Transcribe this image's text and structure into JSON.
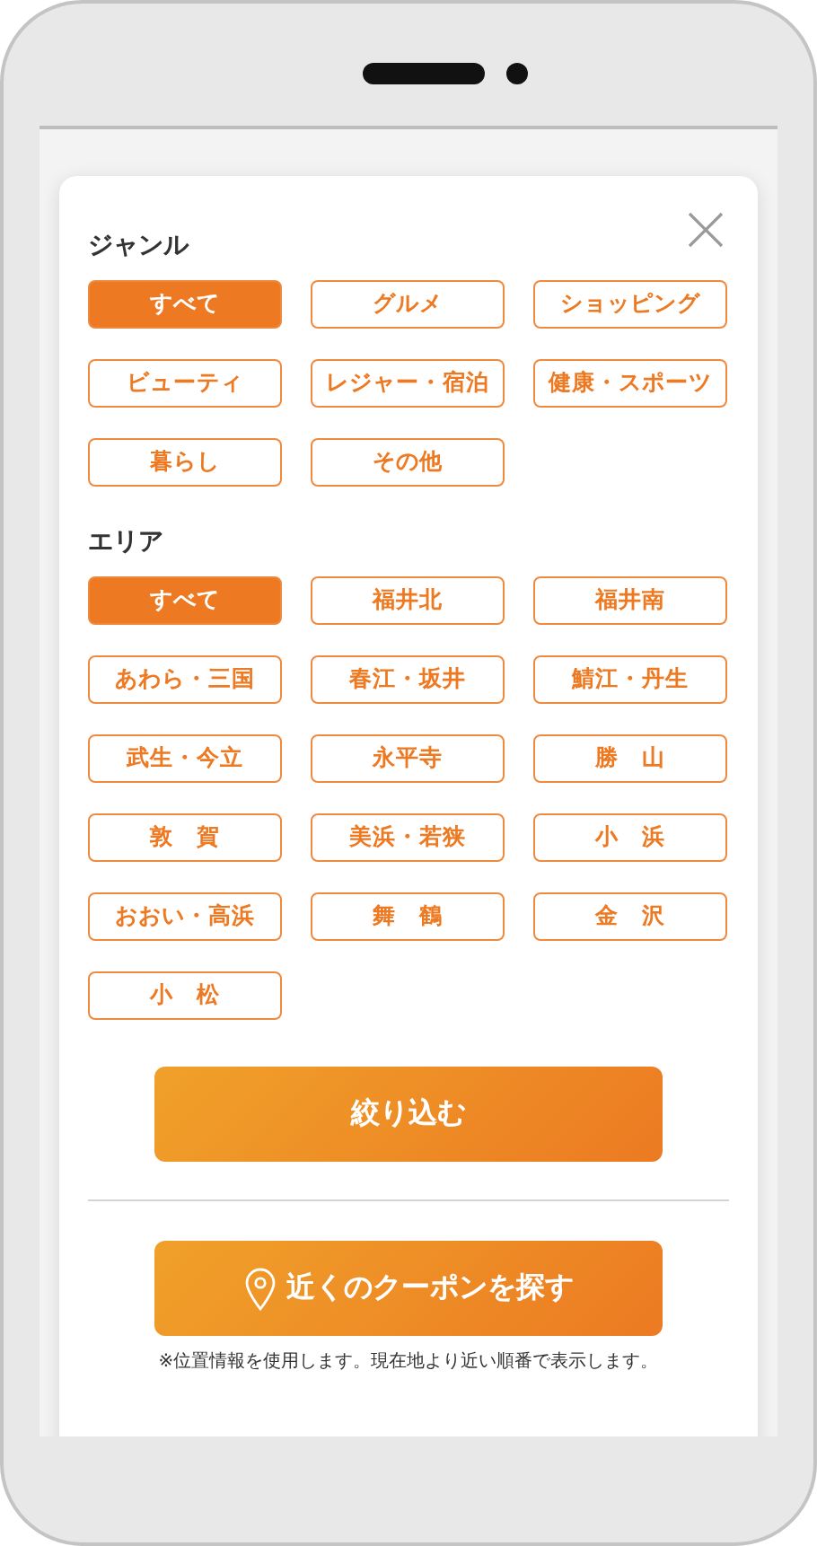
{
  "genre": {
    "heading": "ジャンル",
    "items": [
      {
        "label": "すべて",
        "selected": true
      },
      {
        "label": "グルメ",
        "selected": false
      },
      {
        "label": "ショッピング",
        "selected": false
      },
      {
        "label": "ビューティ",
        "selected": false
      },
      {
        "label": "レジャー・宿泊",
        "selected": false
      },
      {
        "label": "健康・スポーツ",
        "selected": false
      },
      {
        "label": "暮らし",
        "selected": false
      },
      {
        "label": "その他",
        "selected": false
      }
    ]
  },
  "area": {
    "heading": "エリア",
    "items": [
      {
        "label": "すべて",
        "selected": true
      },
      {
        "label": "福井北",
        "selected": false
      },
      {
        "label": "福井南",
        "selected": false
      },
      {
        "label": "あわら・三国",
        "selected": false
      },
      {
        "label": "春江・坂井",
        "selected": false
      },
      {
        "label": "鯖江・丹生",
        "selected": false
      },
      {
        "label": "武生・今立",
        "selected": false
      },
      {
        "label": "永平寺",
        "selected": false
      },
      {
        "label": "勝　山",
        "selected": false
      },
      {
        "label": "敦　賀",
        "selected": false
      },
      {
        "label": "美浜・若狭",
        "selected": false
      },
      {
        "label": "小　浜",
        "selected": false
      },
      {
        "label": "おおい・高浜",
        "selected": false
      },
      {
        "label": "舞　鶴",
        "selected": false
      },
      {
        "label": "金　沢",
        "selected": false
      },
      {
        "label": "小　松",
        "selected": false
      }
    ]
  },
  "filter_button": "絞り込む",
  "location_button": "近くのクーポンを探す",
  "note": "※位置情報を使用します。現在地より近い順番で表示します。"
}
